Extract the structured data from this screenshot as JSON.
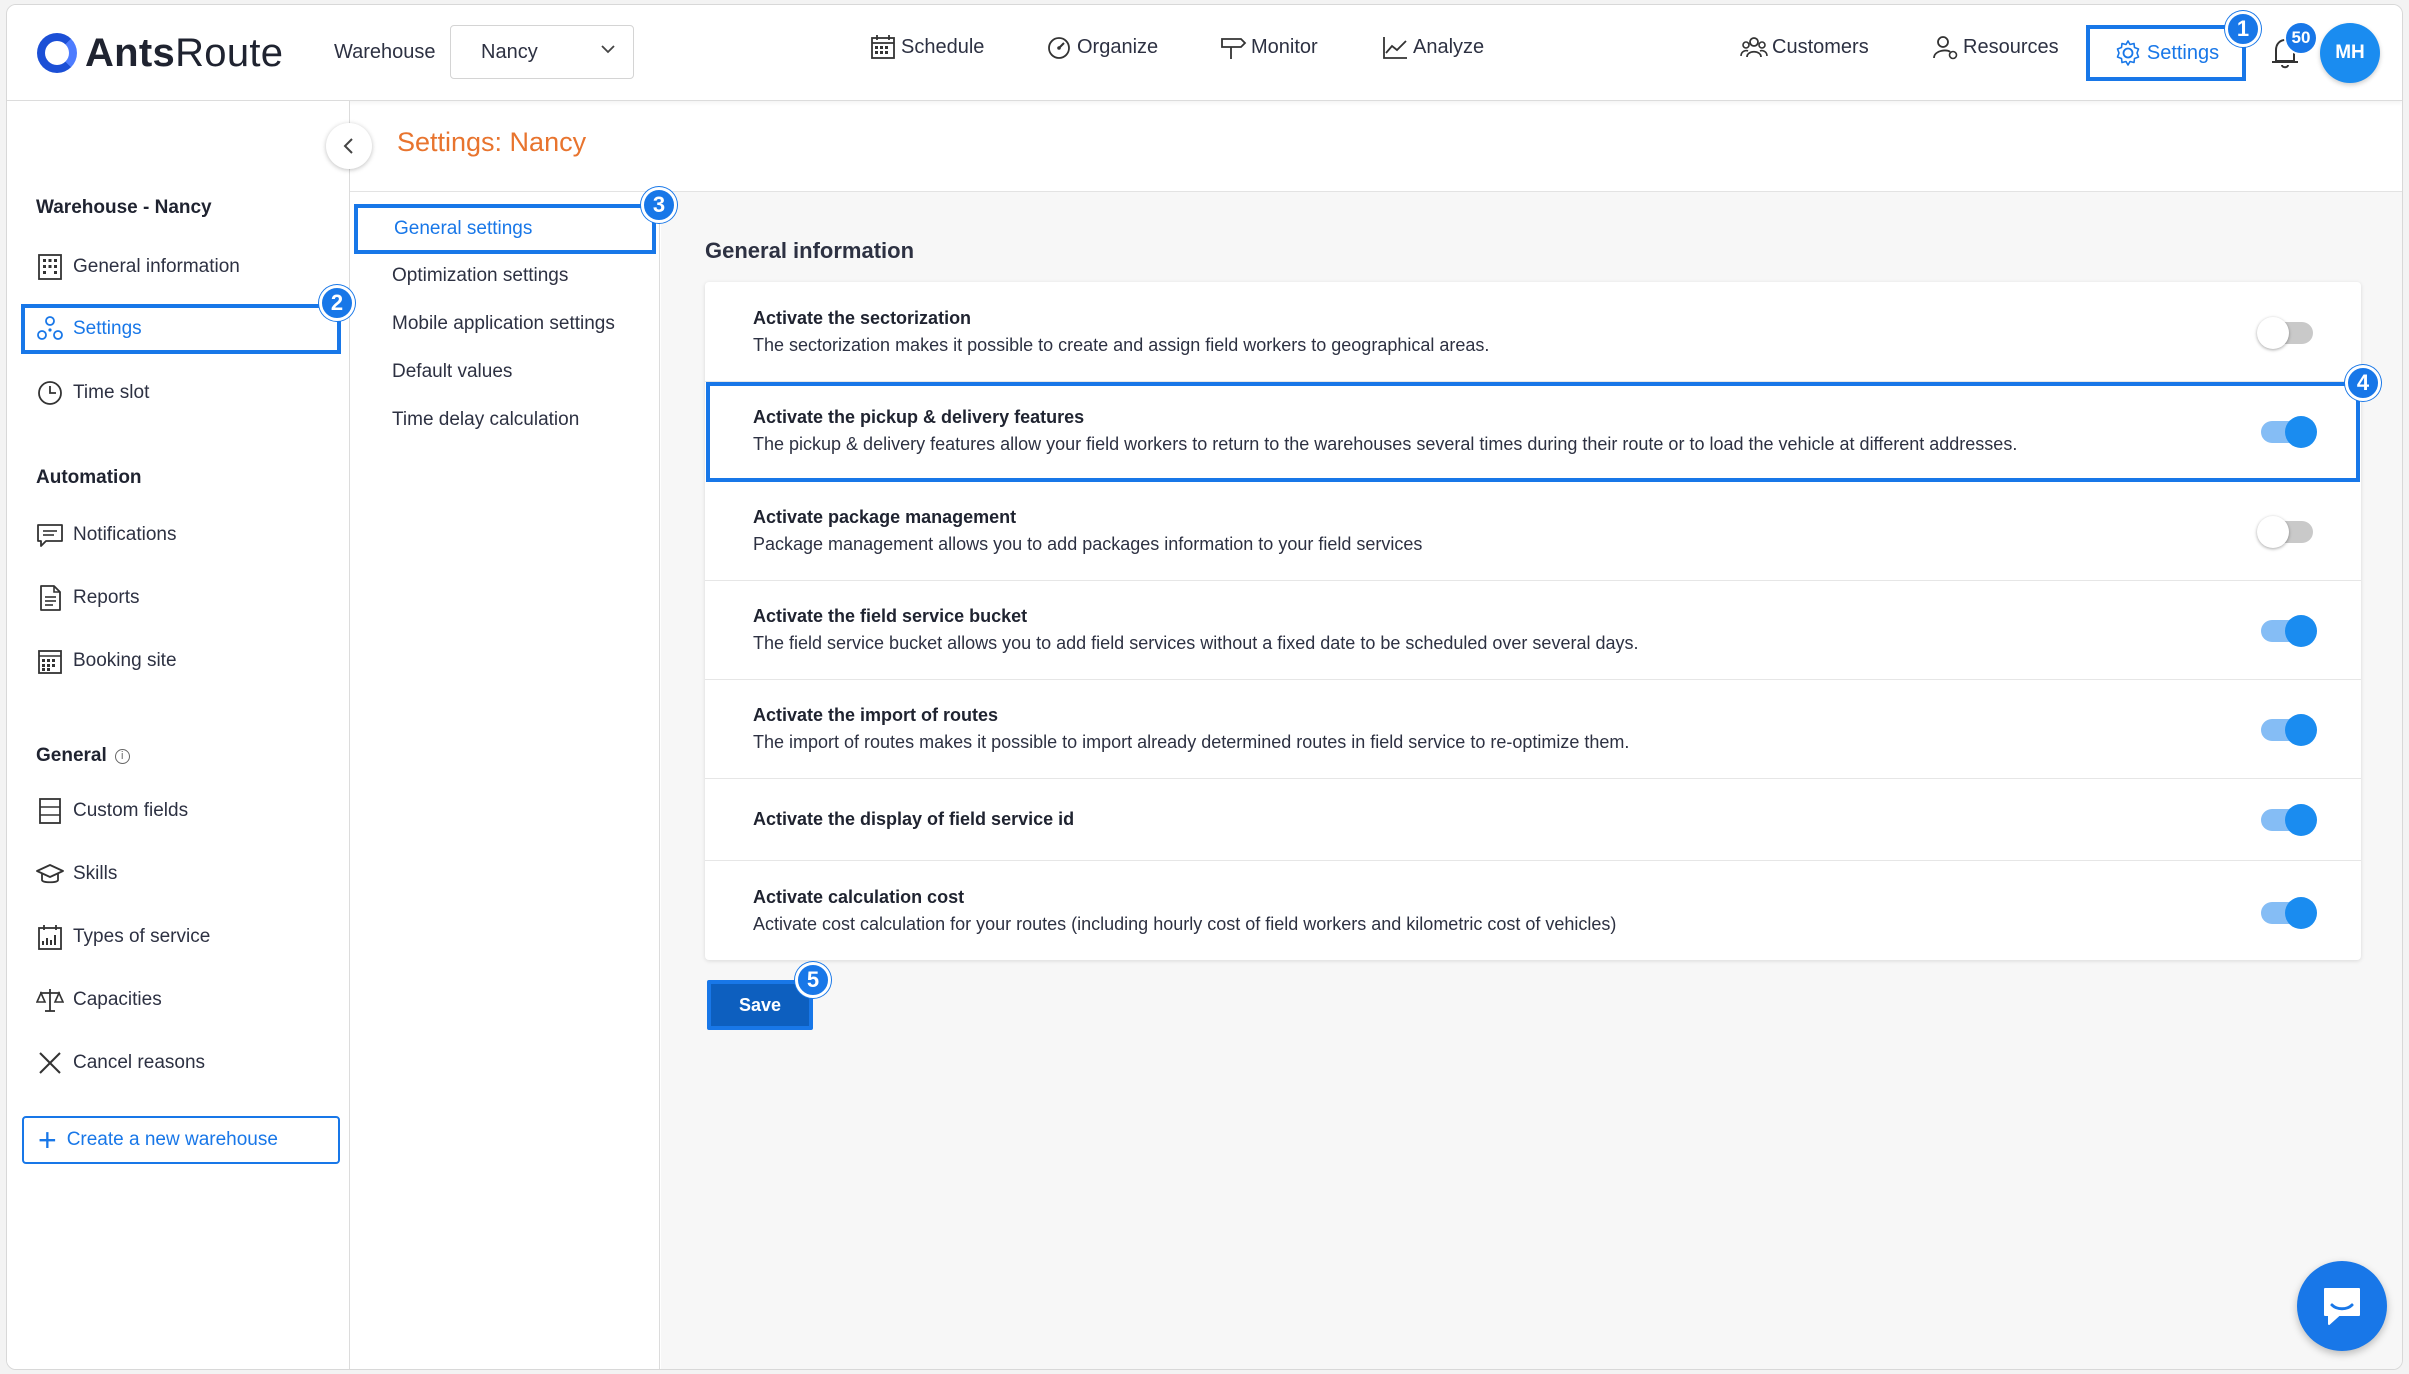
{
  "brand": {
    "name_bold": "Ants",
    "name_rest": "Route"
  },
  "warehouse": {
    "label": "Warehouse",
    "selected": "Nancy"
  },
  "nav": {
    "schedule": "Schedule",
    "organize": "Organize",
    "monitor": "Monitor",
    "analyze": "Analyze",
    "customers": "Customers",
    "resources": "Resources",
    "settings": "Settings"
  },
  "notifications": {
    "count": "50"
  },
  "user": {
    "initials": "MH"
  },
  "steps": {
    "s1": "1",
    "s2": "2",
    "s3": "3",
    "s4": "4",
    "s5": "5"
  },
  "sidebar": {
    "warehouse_title": "Warehouse - Nancy",
    "warehouse_items": [
      "General information",
      "Settings",
      "Time slot"
    ],
    "automation_title": "Automation",
    "automation_items": [
      "Notifications",
      "Reports",
      "Booking site"
    ],
    "general_title": "General",
    "general_items": [
      "Custom fields",
      "Skills",
      "Types of service",
      "Capacities",
      "Cancel reasons"
    ],
    "new_warehouse": "Create a new warehouse"
  },
  "page": {
    "title": "Settings: Nancy"
  },
  "submenu": [
    "General settings",
    "Optimization settings",
    "Mobile application settings",
    "Default values",
    "Time delay calculation"
  ],
  "main": {
    "section_title": "General information",
    "rows": [
      {
        "title": "Activate the sectorization",
        "desc": "The sectorization makes it possible to create and assign field workers to geographical areas.",
        "enabled": false
      },
      {
        "title": "Activate the pickup & delivery features",
        "desc": "The pickup & delivery features allow your field workers to return to the warehouses several times during their route or to load the vehicle at different addresses.",
        "enabled": true
      },
      {
        "title": "Activate package management",
        "desc": "Package management allows you to add packages information to your field services",
        "enabled": false
      },
      {
        "title": "Activate the field service bucket",
        "desc": "The field service bucket allows you to add field services without a fixed date to be scheduled over several days.",
        "enabled": true
      },
      {
        "title": "Activate the import of routes",
        "desc": "The import of routes makes it possible to import already determined routes in field service to re-optimize them.",
        "enabled": true
      },
      {
        "title": "Activate the display of field service id",
        "desc": "",
        "enabled": true
      },
      {
        "title": "Activate calculation cost",
        "desc": "Activate cost calculation for your routes (including hourly cost of field workers and kilometric cost of vehicles)",
        "enabled": true
      }
    ],
    "save_label": "Save"
  },
  "colors": {
    "accent": "#1877e8",
    "title_orange": "#e8742e",
    "toggle_on": "#1a8cf0"
  }
}
